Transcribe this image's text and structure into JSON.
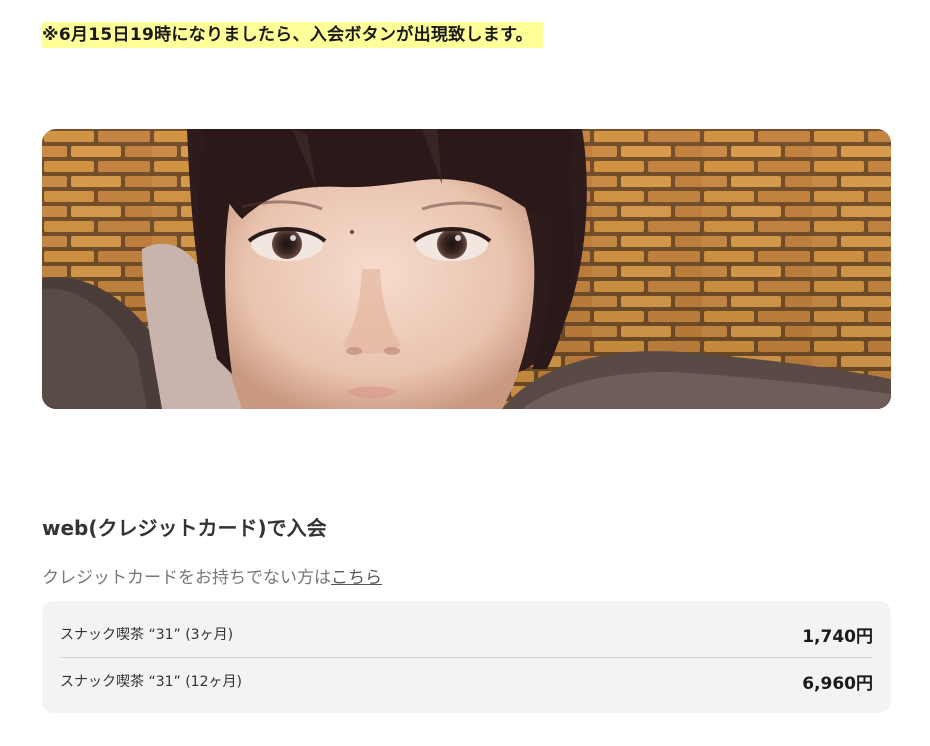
{
  "notice": {
    "text": "※6月15日19時になりましたら、入会ボタンが出現致します。",
    "highlight_color": "#ffff99"
  },
  "hero": {
    "description_icon": "portrait-photo"
  },
  "membership": {
    "title": "web(クレジットカード)で入会",
    "note_prefix": "クレジットカードをお持ちでない方は",
    "note_link": "こちら",
    "plans": [
      {
        "name": "スナック喫茶 “31” (3ヶ月)",
        "price": "1,740円"
      },
      {
        "name": "スナック喫茶 “31” (12ヶ月)",
        "price": "6,960円"
      }
    ]
  },
  "colors": {
    "panel_bg": "#f3f3f3",
    "text": "#333333",
    "muted": "#777777"
  }
}
